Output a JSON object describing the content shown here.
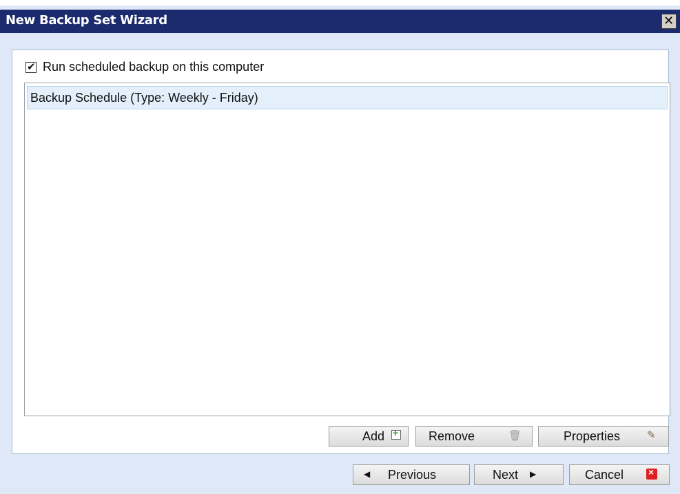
{
  "window": {
    "title": "New Backup Set Wizard"
  },
  "schedule": {
    "checkbox_label": "Run scheduled backup on this computer",
    "checked": true,
    "items": [
      {
        "label": "Backup Schedule (Type: Weekly - Friday)"
      }
    ]
  },
  "list_buttons": {
    "add": "Add",
    "remove": "Remove",
    "properties": "Properties"
  },
  "nav_buttons": {
    "previous": "Previous",
    "next": "Next",
    "cancel": "Cancel"
  },
  "icons": {
    "close": "close-icon",
    "add": "add-icon",
    "remove": "trash-icon",
    "properties": "edit-icon",
    "previous": "previous-arrow-icon",
    "next": "next-arrow-icon",
    "cancel": "cancel-icon"
  },
  "colors": {
    "titlebar": "#1c2a6e",
    "dialog_bg": "#dfe8f6",
    "selected_row": "#e3f0fb",
    "cancel_red": "#e02020",
    "add_green": "#2e9e2e"
  }
}
